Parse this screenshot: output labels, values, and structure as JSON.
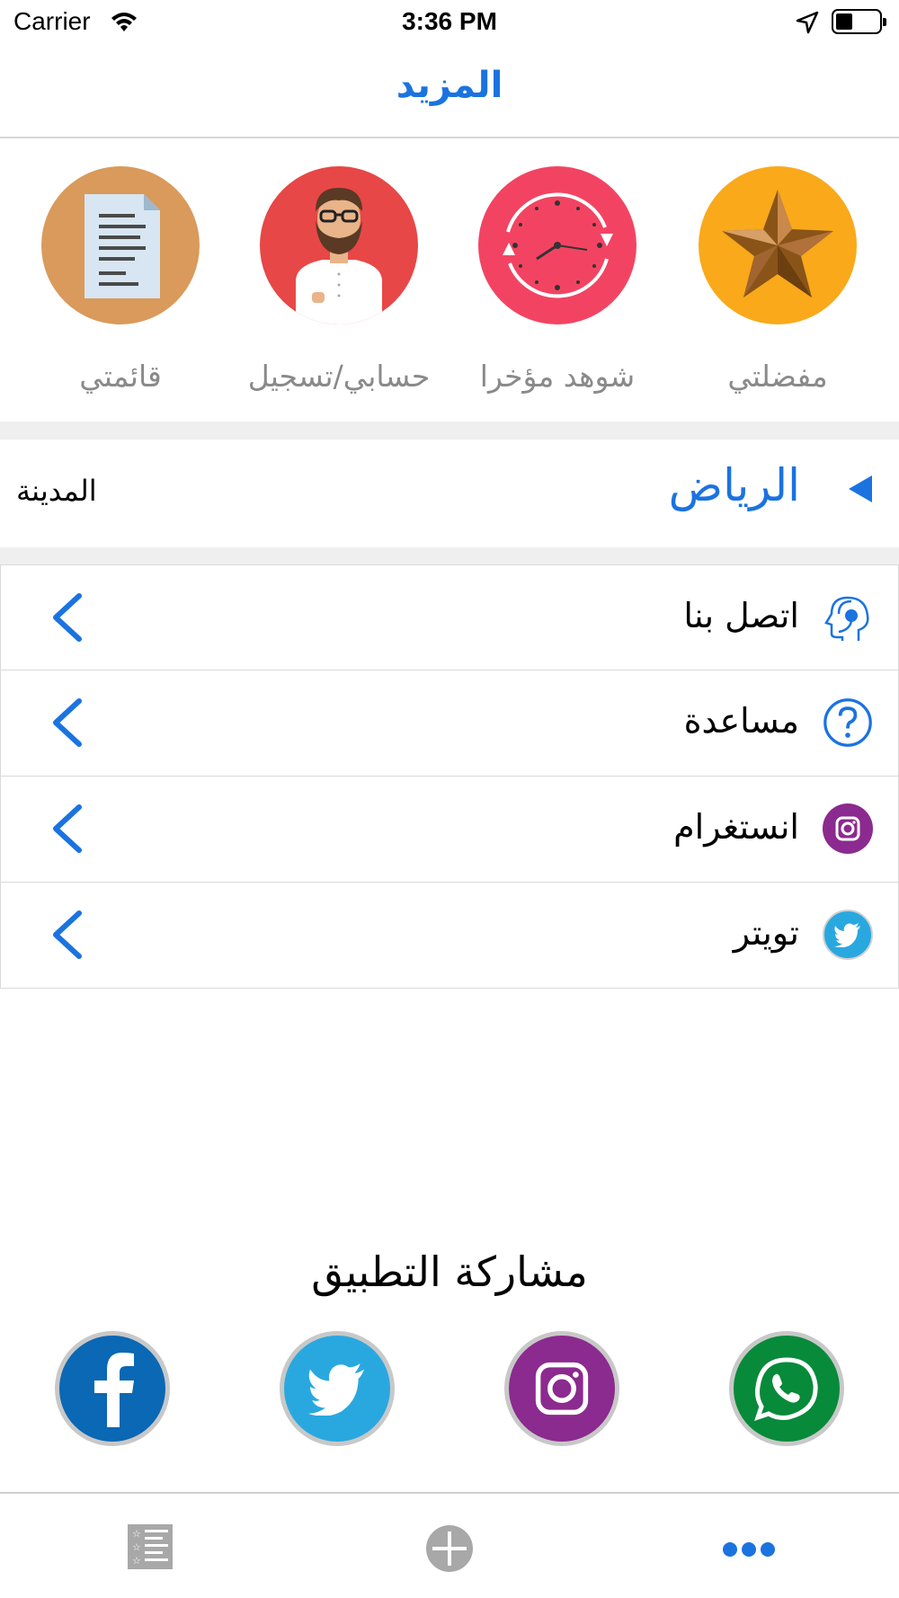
{
  "status_bar": {
    "carrier": "Carrier",
    "time": "3:36 PM"
  },
  "nav": {
    "title": "المزيد"
  },
  "quick_actions": [
    {
      "label": "مفضلتي",
      "icon": "star-icon",
      "color": "#f9a91a"
    },
    {
      "label": "شوهد مؤخرا",
      "icon": "clock-icon",
      "color": "#f24462"
    },
    {
      "label": "حسابي/تسجيل",
      "icon": "user-avatar-icon",
      "color": "#e74747"
    },
    {
      "label": "قائمتي",
      "icon": "document-list-icon",
      "color": "#d99a5b"
    }
  ],
  "city": {
    "label": "المدينة",
    "value": "الرياض"
  },
  "menu": [
    {
      "label": "اتصل بنا",
      "icon": "support-headset-icon"
    },
    {
      "label": "مساعدة",
      "icon": "help-question-icon"
    },
    {
      "label": "انستغرام",
      "icon": "instagram-icon",
      "color": "#8b2a8f"
    },
    {
      "label": "تويتر",
      "icon": "twitter-icon",
      "color": "#29a8e0"
    }
  ],
  "share": {
    "title": "مشاركة التطبيق",
    "buttons": [
      {
        "name": "facebook",
        "color": "#0a68b4"
      },
      {
        "name": "twitter",
        "color": "#29a8e0"
      },
      {
        "name": "instagram",
        "color": "#8b2a8f"
      },
      {
        "name": "whatsapp",
        "color": "#078a3a"
      }
    ]
  },
  "tabs": [
    {
      "name": "list-tab",
      "icon": "list-icon",
      "active": false
    },
    {
      "name": "add-tab",
      "icon": "plus-circle-icon",
      "active": false
    },
    {
      "name": "more-tab",
      "icon": "more-dots-icon",
      "active": true
    }
  ],
  "colors": {
    "accent": "#1b73e0",
    "inactive_tab": "#a8a8a8",
    "separator": "#efefef"
  }
}
